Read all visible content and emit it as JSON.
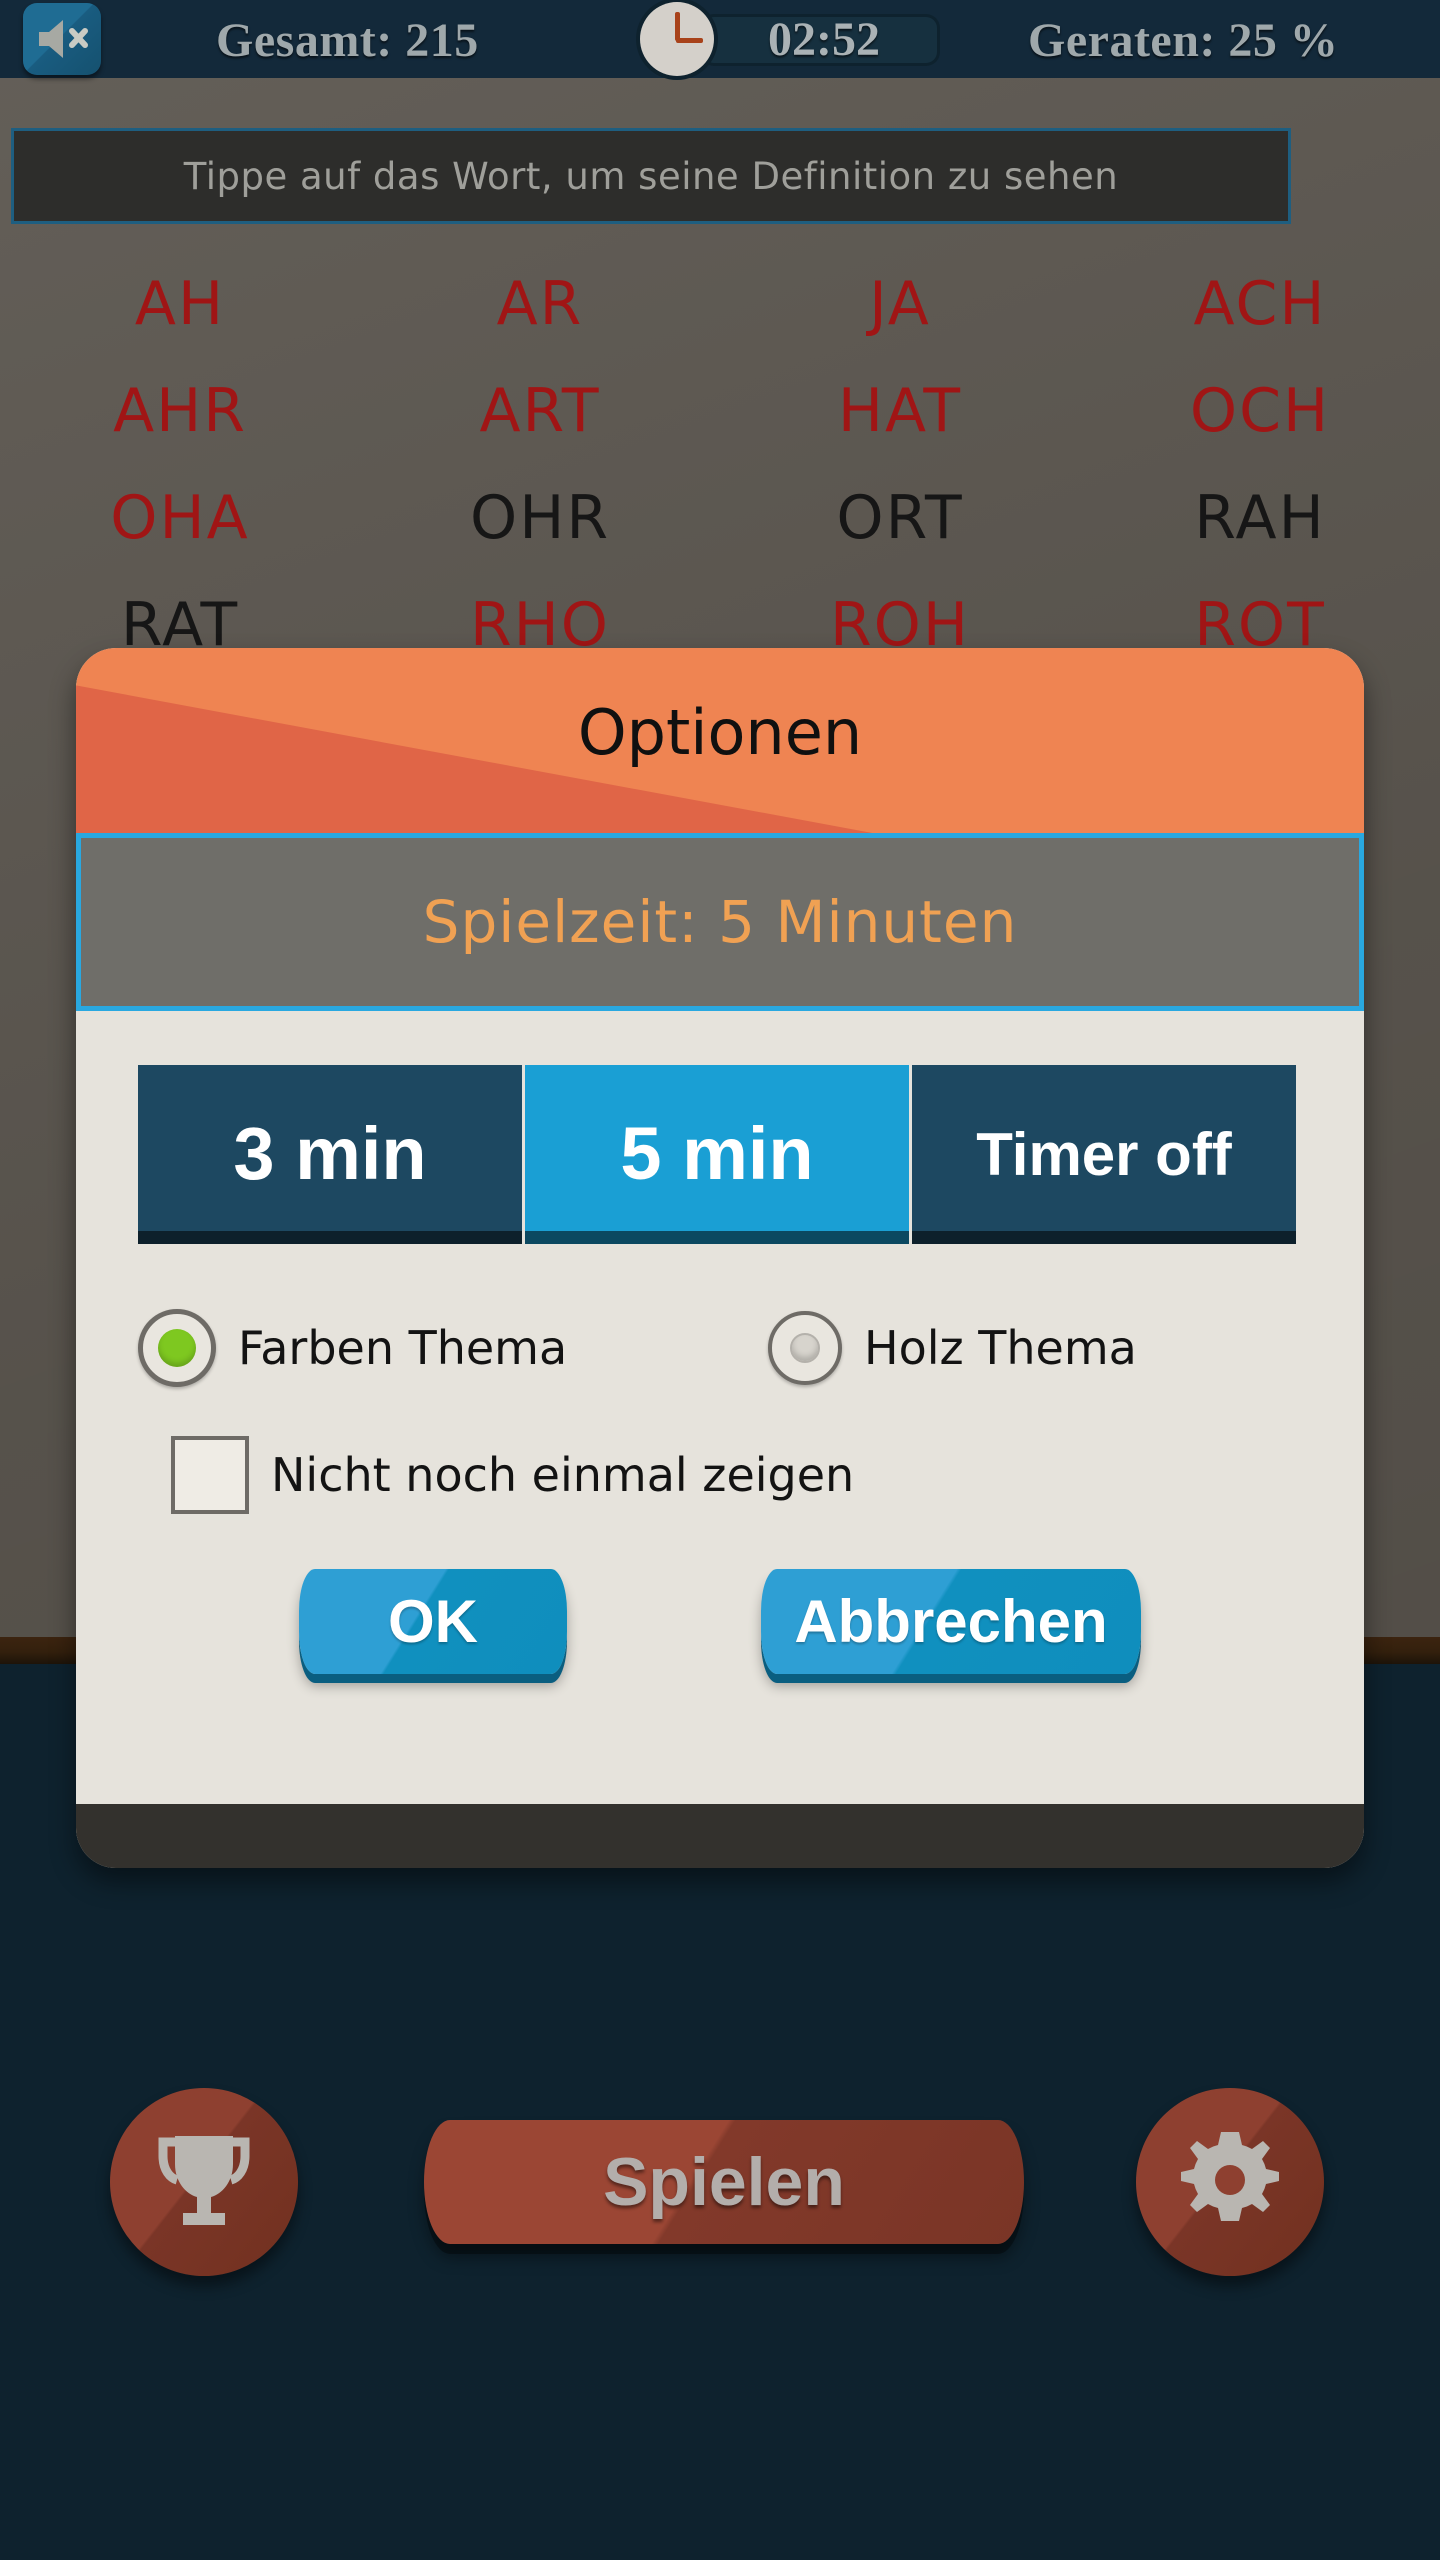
{
  "topbar": {
    "mute_icon": "speaker-muted-icon",
    "total_label": "Gesamt: 215",
    "timer_icon": "clock-icon",
    "timer_value": "02:52",
    "guessed_label": "Geraten: 25 %"
  },
  "hint": {
    "text": "Tippe auf das Wort, um seine Definition zu sehen"
  },
  "grid": {
    "rows": [
      [
        {
          "word": "AH",
          "state": "red"
        },
        {
          "word": "AR",
          "state": "red"
        },
        {
          "word": "JA",
          "state": "red"
        },
        {
          "word": "ACH",
          "state": "red"
        }
      ],
      [
        {
          "word": "AHR",
          "state": "red"
        },
        {
          "word": "ART",
          "state": "red"
        },
        {
          "word": "HAT",
          "state": "red"
        },
        {
          "word": "OCH",
          "state": "red"
        }
      ],
      [
        {
          "word": "OHA",
          "state": "red"
        },
        {
          "word": "OHR",
          "state": "black"
        },
        {
          "word": "ORT",
          "state": "black"
        },
        {
          "word": "RAH",
          "state": "black"
        }
      ],
      [
        {
          "word": "RAT",
          "state": "black"
        },
        {
          "word": "RHO",
          "state": "red"
        },
        {
          "word": "ROH",
          "state": "red"
        },
        {
          "word": "ROT",
          "state": "red"
        }
      ]
    ]
  },
  "dialog": {
    "title": "Optionen",
    "playtime_label": "Spielzeit: 5 Minuten",
    "timer_options": [
      {
        "label": "3 min",
        "selected": false
      },
      {
        "label": "5 min",
        "selected": true
      },
      {
        "label": "Timer off",
        "selected": false
      }
    ],
    "theme_options": [
      {
        "label": "Farben Thema",
        "selected": true
      },
      {
        "label": "Holz Thema",
        "selected": false
      }
    ],
    "dont_show_label": "Nicht noch einmal zeigen",
    "dont_show_checked": false,
    "ok_label": "OK",
    "cancel_label": "Abbrechen"
  },
  "bottomnav": {
    "trophy_icon": "trophy-icon",
    "play_label": "Spielen",
    "gear_icon": "gear-icon"
  },
  "colors": {
    "accent_blue": "#1a9fd4",
    "dark_blue": "#1d4861",
    "header_orange": "#ef8452",
    "header_orange_dark": "#e06547",
    "playtime_orange": "#f0a153",
    "radio_green": "#7ec820",
    "word_red": "#a01515",
    "word_black": "#161616",
    "board_gray": "#5c5750",
    "dialog_bg": "#e6e3dc",
    "app_bg": "#0e222e",
    "brown": "#8e4030"
  }
}
